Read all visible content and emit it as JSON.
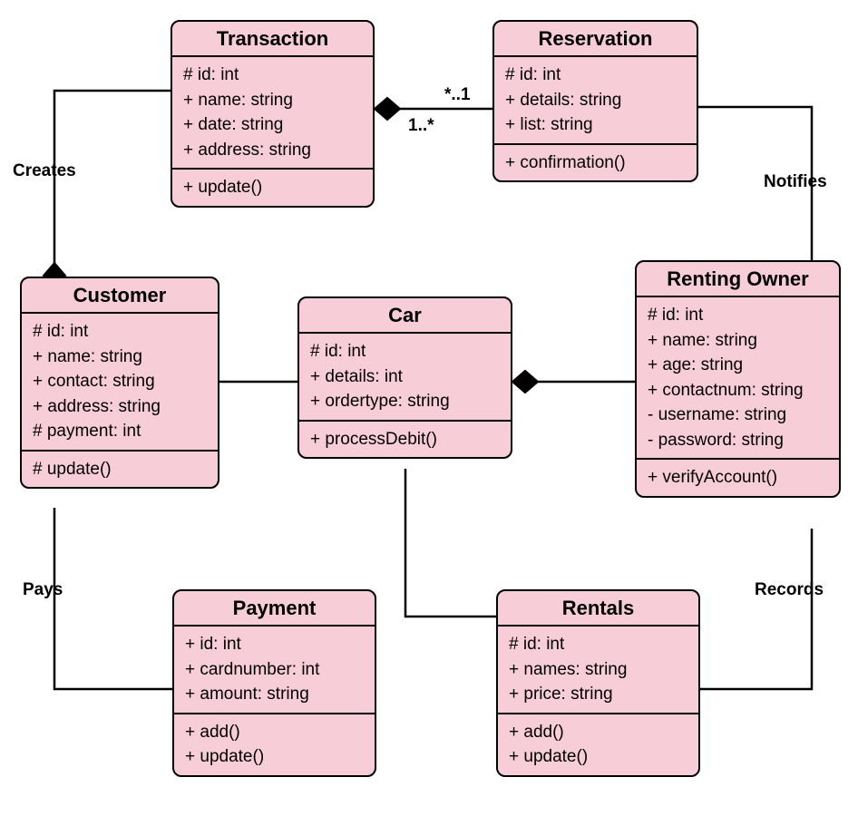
{
  "diagram_type": "UML Class Diagram",
  "classes": {
    "transaction": {
      "name": "Transaction",
      "attributes": [
        "# id: int",
        "+ name: string",
        "+ date: string",
        "+ address: string"
      ],
      "methods": [
        "+ update()"
      ]
    },
    "reservation": {
      "name": "Reservation",
      "attributes": [
        "# id: int",
        "+ details: string",
        "+ list: string"
      ],
      "methods": [
        "+ confirmation()"
      ]
    },
    "customer": {
      "name": "Customer",
      "attributes": [
        "# id: int",
        "+ name: string",
        "+ contact: string",
        "+ address: string",
        "# payment: int"
      ],
      "methods": [
        "# update()"
      ]
    },
    "car": {
      "name": "Car",
      "attributes": [
        "# id: int",
        "+ details: int",
        "+ ordertype: string"
      ],
      "methods": [
        "+ processDebit()"
      ]
    },
    "renting_owner": {
      "name": "Renting Owner",
      "attributes": [
        "# id: int",
        "+ name: string",
        "+ age: string",
        "+ contactnum: string",
        "- username: string",
        "- password: string"
      ],
      "methods": [
        "+ verifyAccount()"
      ]
    },
    "payment": {
      "name": "Payment",
      "attributes": [
        "+ id: int",
        "+ cardnumber: int",
        "+ amount: string"
      ],
      "methods": [
        "+ add()",
        "+ update()"
      ]
    },
    "rentals": {
      "name": "Rentals",
      "attributes": [
        "# id: int",
        "+ names: string",
        "+ price: string"
      ],
      "methods": [
        "+ add()",
        "+ update()"
      ]
    }
  },
  "edges": {
    "creates": {
      "label": "Creates"
    },
    "notifies": {
      "label": "Notifies"
    },
    "pays": {
      "label": "Pays"
    },
    "records": {
      "label": "Records"
    },
    "trans_res_left": {
      "mult": "*..1"
    },
    "trans_res_right": {
      "mult": "1..*"
    }
  }
}
